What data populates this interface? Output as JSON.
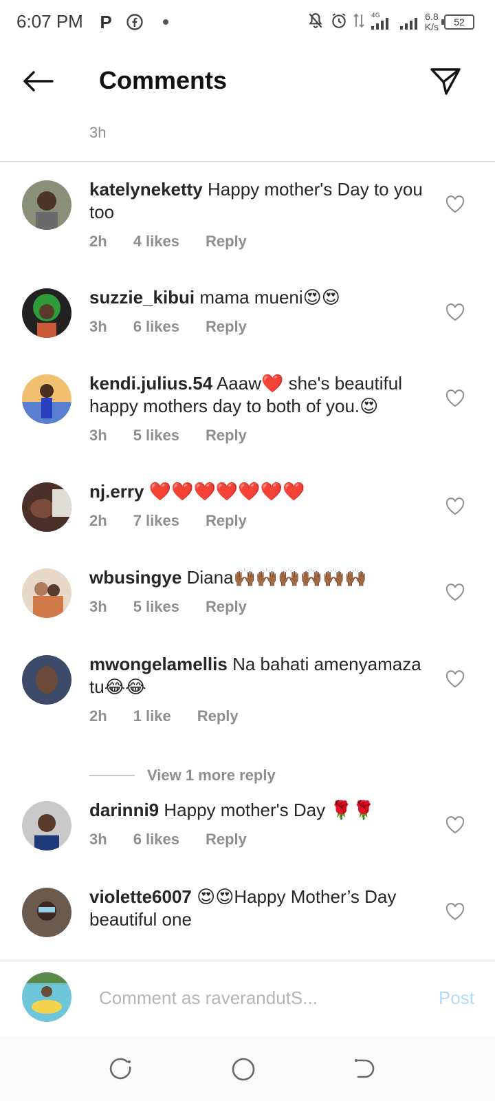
{
  "status_bar": {
    "time": "6:07 PM",
    "app_letter": "P",
    "net_speed_value": "6.8",
    "net_speed_unit": "K/s",
    "battery": "52"
  },
  "header": {
    "title": "Comments"
  },
  "top_comment_time": "3h",
  "comments": [
    {
      "username": "katelyneketty",
      "text": "Happy mother's Day to you too",
      "time": "2h",
      "likes": "4 likes",
      "reply": "Reply",
      "avatar_color": "#8a8f7a"
    },
    {
      "username": "suzzie_kibui",
      "text": "mama mueni😍😍",
      "time": "3h",
      "likes": "6 likes",
      "reply": "Reply",
      "avatar_color": "#2f9a3a"
    },
    {
      "username": "kendi.julius.54",
      "text": "Aaaw❤️ she's beautiful happy mothers day to both of you.😍",
      "time": "3h",
      "likes": "5 likes",
      "reply": "Reply",
      "avatar_color": "#5a7fd0"
    },
    {
      "username": "nj.erry",
      "text": "❤️❤️❤️❤️❤️❤️❤️",
      "time": "2h",
      "likes": "7 likes",
      "reply": "Reply",
      "avatar_color": "#4a3028"
    },
    {
      "username": "wbusingye",
      "text": "Diana🙌🏾🙌🏾🙌🏾🙌🏾🙌🏾🙌🏾",
      "time": "3h",
      "likes": "5 likes",
      "reply": "Reply",
      "avatar_color": "#b07a5c"
    },
    {
      "username": "mwongelamellis",
      "text": "Na bahati amenyamaza tu😂😂",
      "time": "2h",
      "likes": "1 like",
      "reply": "Reply",
      "avatar_color": "#3e4a6a"
    },
    {
      "username": "darinni9",
      "text": "Happy mother's Day 🌹🌹",
      "time": "3h",
      "likes": "6 likes",
      "reply": "Reply",
      "avatar_color": "#c9c9c9"
    },
    {
      "username": "violette6007",
      "text": "😍😍Happy Mother’s Day beautiful one",
      "time": "",
      "likes": "",
      "reply": "",
      "avatar_color": "#6b5a4e"
    }
  ],
  "view_more_replies": "View 1 more reply",
  "composer": {
    "placeholder": "Comment as raverandutS...",
    "post_label": "Post"
  },
  "colors": {
    "accent_disabled": "#b3dbff",
    "secondary_text": "#8e8e8e",
    "divider": "#dbdbdb"
  }
}
